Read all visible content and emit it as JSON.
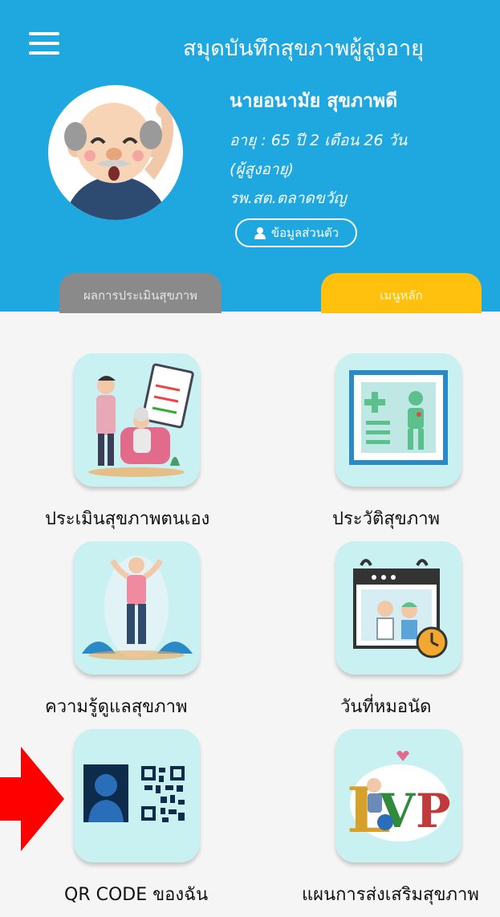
{
  "header": {
    "title": "สมุดบันทึกสุขภาพผู้สูงอายุ",
    "user_name": "นายอนามัย สุขภาพดี",
    "age": "อายุ : 65 ปี 2 เดือน 26 วัน",
    "group": "(ผู้สูงอายุ)",
    "facility": "รพ.สต.ตลาดขวัญ",
    "profile_button": "ข้อมูลส่วนตัว"
  },
  "tabs": {
    "left": "ผลการประเมินสุขภาพ",
    "right": "เมนูหลัก"
  },
  "menu": {
    "self_assessment": "ประเมินสุขภาพตนเอง",
    "health_history": "ประวัติสุขภาพ",
    "health_knowledge": "ความรู้ดูแลสุขภาพ",
    "appointment": "วันที่หมอนัด",
    "qr_code": "QR CODE ของฉัน",
    "promotion_plan": "แผนการส่งเสริมสุขภาพ"
  },
  "colors": {
    "header": "#1fa7e0",
    "tab_active": "#ffc10e",
    "tab_inactive": "#8a8a8a",
    "tile_bg": "#c9f1f2",
    "arrow": "#ff0000"
  }
}
